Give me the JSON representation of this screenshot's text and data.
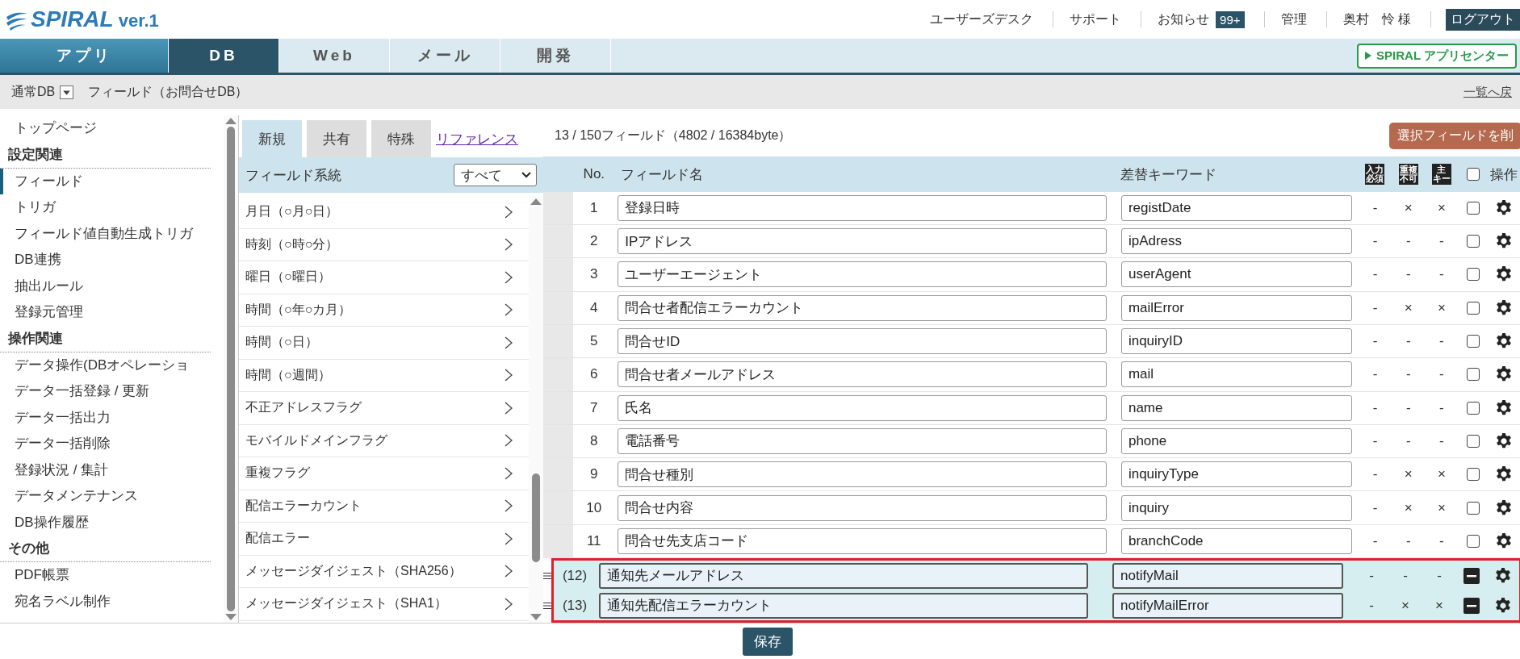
{
  "header": {
    "logo": "SPIRAL",
    "version": "ver.1",
    "links": [
      {
        "label": "ユーザーズデスク"
      },
      {
        "label": "サポート"
      },
      {
        "label": "お知らせ",
        "badge": "99+"
      },
      {
        "label": "管理"
      },
      {
        "label": "奥村　怜 様"
      }
    ],
    "logout": "ログアウト"
  },
  "nav": {
    "tabs": [
      {
        "label": "アプリ",
        "kind": "primary",
        "selected": false
      },
      {
        "label": "DB",
        "kind": "plain",
        "selected": true
      },
      {
        "label": "Web",
        "kind": "plain",
        "selected": false
      },
      {
        "label": "メール",
        "kind": "plain",
        "selected": false
      },
      {
        "label": "開発",
        "kind": "plain",
        "selected": false
      }
    ],
    "app_center": "SPIRAL アプリセンター"
  },
  "breadcrumb": {
    "db_type": "通常DB",
    "title": "フィールド（お問合せDB）",
    "back_link": "一覧へ戻"
  },
  "sidebar": {
    "top_item": {
      "label": "トップページ",
      "selected": false
    },
    "sections": [
      {
        "heading": "設定関連",
        "items": [
          {
            "label": "フィールド",
            "selected": true
          },
          {
            "label": "トリガ",
            "selected": false
          },
          {
            "label": "フィールド値自動生成トリガ",
            "selected": false
          },
          {
            "label": "DB連携",
            "selected": false
          },
          {
            "label": "抽出ルール",
            "selected": false
          },
          {
            "label": "登録元管理",
            "selected": false
          }
        ]
      },
      {
        "heading": "操作関連",
        "items": [
          {
            "label": "データ操作(DBオペレーショ",
            "selected": false
          },
          {
            "label": "データ一括登録 / 更新",
            "selected": false
          },
          {
            "label": "データ一括出力",
            "selected": false
          },
          {
            "label": "データ一括削除",
            "selected": false
          },
          {
            "label": "登録状況 / 集計",
            "selected": false
          },
          {
            "label": "データメンテナンス",
            "selected": false
          },
          {
            "label": "DB操作履歴",
            "selected": false
          }
        ]
      },
      {
        "heading": "その他",
        "items": [
          {
            "label": "PDF帳票",
            "selected": false
          },
          {
            "label": "宛名ラベル制作",
            "selected": false
          }
        ]
      }
    ]
  },
  "field_types": {
    "tabs": [
      {
        "label": "新規",
        "selected": true
      },
      {
        "label": "共有",
        "selected": false
      },
      {
        "label": "特殊",
        "selected": false
      }
    ],
    "reference_link": "リファレンス",
    "filter_label": "フィールド系統",
    "filter_value": "すべて",
    "items": [
      "月日（○月○日）",
      "時刻（○時○分）",
      "曜日（○曜日）",
      "時間（○年○カ月）",
      "時間（○日）",
      "時間（○週間）",
      "不正アドレスフラグ",
      "モバイルドメインフラグ",
      "重複フラグ",
      "配信エラーカウント",
      "配信エラー",
      "メッセージダイジェスト（SHA256）",
      "メッセージダイジェスト（SHA1）"
    ]
  },
  "table": {
    "summary": "13 / 150フィールド（4802 / 16384byte）",
    "delete_button": "選択フィールドを削",
    "columns": {
      "no": "No.",
      "name": "フィールド名",
      "keyword": "差替キーワード",
      "flags": [
        {
          "lines": [
            "入力",
            "必須"
          ]
        },
        {
          "lines": [
            "重複",
            "不可"
          ]
        },
        {
          "lines": [
            "主",
            "キー"
          ]
        }
      ],
      "actions": "操作"
    },
    "select_all": {
      "checked": false
    },
    "rows": [
      {
        "kind": "existing",
        "no": "1",
        "name": "登録日時",
        "keyword": "registDate",
        "flags": [
          "-",
          "×",
          "×"
        ],
        "checked": false
      },
      {
        "kind": "existing",
        "no": "2",
        "name": "IPアドレス",
        "keyword": "ipAdress",
        "flags": [
          "-",
          "-",
          "-"
        ],
        "checked": false
      },
      {
        "kind": "existing",
        "no": "3",
        "name": "ユーザーエージェント",
        "keyword": "userAgent",
        "flags": [
          "-",
          "-",
          "-"
        ],
        "checked": false
      },
      {
        "kind": "existing",
        "no": "4",
        "name": "問合せ者配信エラーカウント",
        "keyword": "mailError",
        "flags": [
          "-",
          "×",
          "×"
        ],
        "checked": false
      },
      {
        "kind": "existing",
        "no": "5",
        "name": "問合せID",
        "keyword": "inquiryID",
        "flags": [
          "-",
          "-",
          "-"
        ],
        "checked": false
      },
      {
        "kind": "existing",
        "no": "6",
        "name": "問合せ者メールアドレス",
        "keyword": "mail",
        "flags": [
          "-",
          "-",
          "-"
        ],
        "checked": false
      },
      {
        "kind": "existing",
        "no": "7",
        "name": "氏名",
        "keyword": "name",
        "flags": [
          "-",
          "-",
          "-"
        ],
        "checked": false
      },
      {
        "kind": "existing",
        "no": "8",
        "name": "電話番号",
        "keyword": "phone",
        "flags": [
          "-",
          "-",
          "-"
        ],
        "checked": false
      },
      {
        "kind": "existing",
        "no": "9",
        "name": "問合せ種別",
        "keyword": "inquiryType",
        "flags": [
          "-",
          "×",
          "×"
        ],
        "checked": false
      },
      {
        "kind": "existing",
        "no": "10",
        "name": "問合せ内容",
        "keyword": "inquiry",
        "flags": [
          "-",
          "×",
          "×"
        ],
        "checked": false
      },
      {
        "kind": "existing",
        "no": "11",
        "name": "問合せ先支店コード",
        "keyword": "branchCode",
        "flags": [
          "-",
          "-",
          "-"
        ],
        "checked": false
      },
      {
        "kind": "new",
        "no": "(12)",
        "name": "通知先メールアドレス",
        "keyword": "notifyMail",
        "flags": [
          "-",
          "-",
          "-"
        ]
      },
      {
        "kind": "new",
        "no": "(13)",
        "name": "通知先配信エラーカウント",
        "keyword": "notifyMailError",
        "flags": [
          "-",
          "×",
          "×"
        ]
      }
    ]
  },
  "save_button": "保存"
}
